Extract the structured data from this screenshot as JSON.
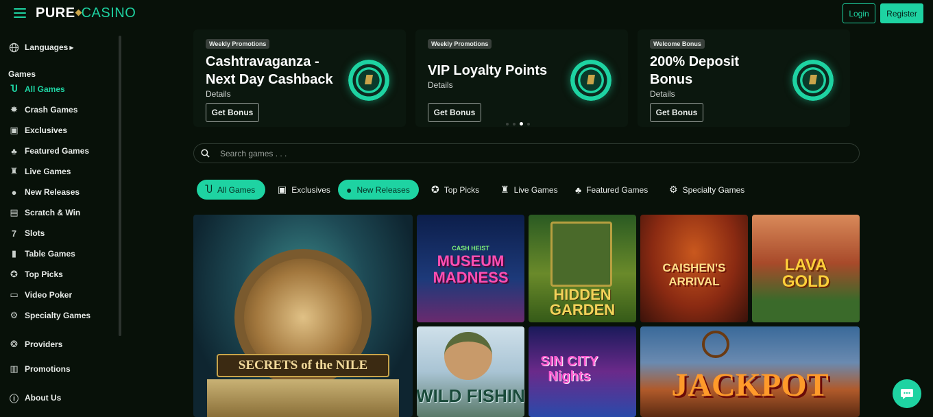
{
  "brand": {
    "pure": "PURE",
    "casino": "CASINO",
    "accent": "#1ed3a2"
  },
  "header": {
    "login_label": "Login",
    "register_label": "Register"
  },
  "sidebar": {
    "languages": "Languages",
    "games_heading": "Games",
    "items": [
      {
        "label": "All Games",
        "icon": "horseshoe-icon",
        "active": true
      },
      {
        "label": "Crash Games",
        "icon": "explosion-icon"
      },
      {
        "label": "Exclusives",
        "icon": "exclusive-badge-icon"
      },
      {
        "label": "Featured Games",
        "icon": "clover-icon"
      },
      {
        "label": "Live Games",
        "icon": "dealer-icon"
      },
      {
        "label": "New Releases",
        "icon": "cherries-icon"
      },
      {
        "label": "Scratch & Win",
        "icon": "scratch-ticket-icon"
      },
      {
        "label": "Slots",
        "icon": "seven-icon"
      },
      {
        "label": "Table Games",
        "icon": "cards-icon"
      },
      {
        "label": "Top Picks",
        "icon": "medal-icon"
      },
      {
        "label": "Video Poker",
        "icon": "video-poker-icon"
      },
      {
        "label": "Specialty Games",
        "icon": "gear-icon"
      }
    ],
    "providers": "Providers",
    "promotions": "Promotions",
    "about": "About Us"
  },
  "promos": [
    {
      "tag": "Weekly Promotions",
      "title": "Cashtravaganza - Next Day Cashback",
      "details": "Details",
      "cta": "Get Bonus"
    },
    {
      "tag": "Weekly Promotions",
      "title": "VIP Loyalty Points",
      "details": "Details",
      "cta": "Get Bonus"
    },
    {
      "tag": "Welcome Bonus",
      "title": "200% Deposit Bonus",
      "details": "Details",
      "cta": "Get Bonus"
    }
  ],
  "search": {
    "placeholder": "Search games . . ."
  },
  "tabs": [
    {
      "label": "All Games",
      "icon": "horseshoe-icon",
      "active": true
    },
    {
      "label": "Exclusives",
      "icon": "exclusive-badge-icon"
    },
    {
      "label": "New Releases",
      "icon": "cherries-icon",
      "active": true
    },
    {
      "label": "Top Picks",
      "icon": "medal-icon"
    },
    {
      "label": "Live Games",
      "icon": "dealer-icon"
    },
    {
      "label": "Featured Games",
      "icon": "clover-icon"
    },
    {
      "label": "Specialty Games",
      "icon": "gear-icon"
    }
  ],
  "games": [
    {
      "name": "SECRETS of the NILE"
    },
    {
      "name": "MUSEUM MADNESS",
      "sub": "CASH HEIST"
    },
    {
      "name": "HIDDEN GARDEN"
    },
    {
      "name": "CAISHEN'S ARRIVAL"
    },
    {
      "name": "LAVA GOLD"
    },
    {
      "name": "WILD FISHIN"
    },
    {
      "name": "SIN CITY Nights"
    },
    {
      "name": "JACKPOT"
    }
  ]
}
